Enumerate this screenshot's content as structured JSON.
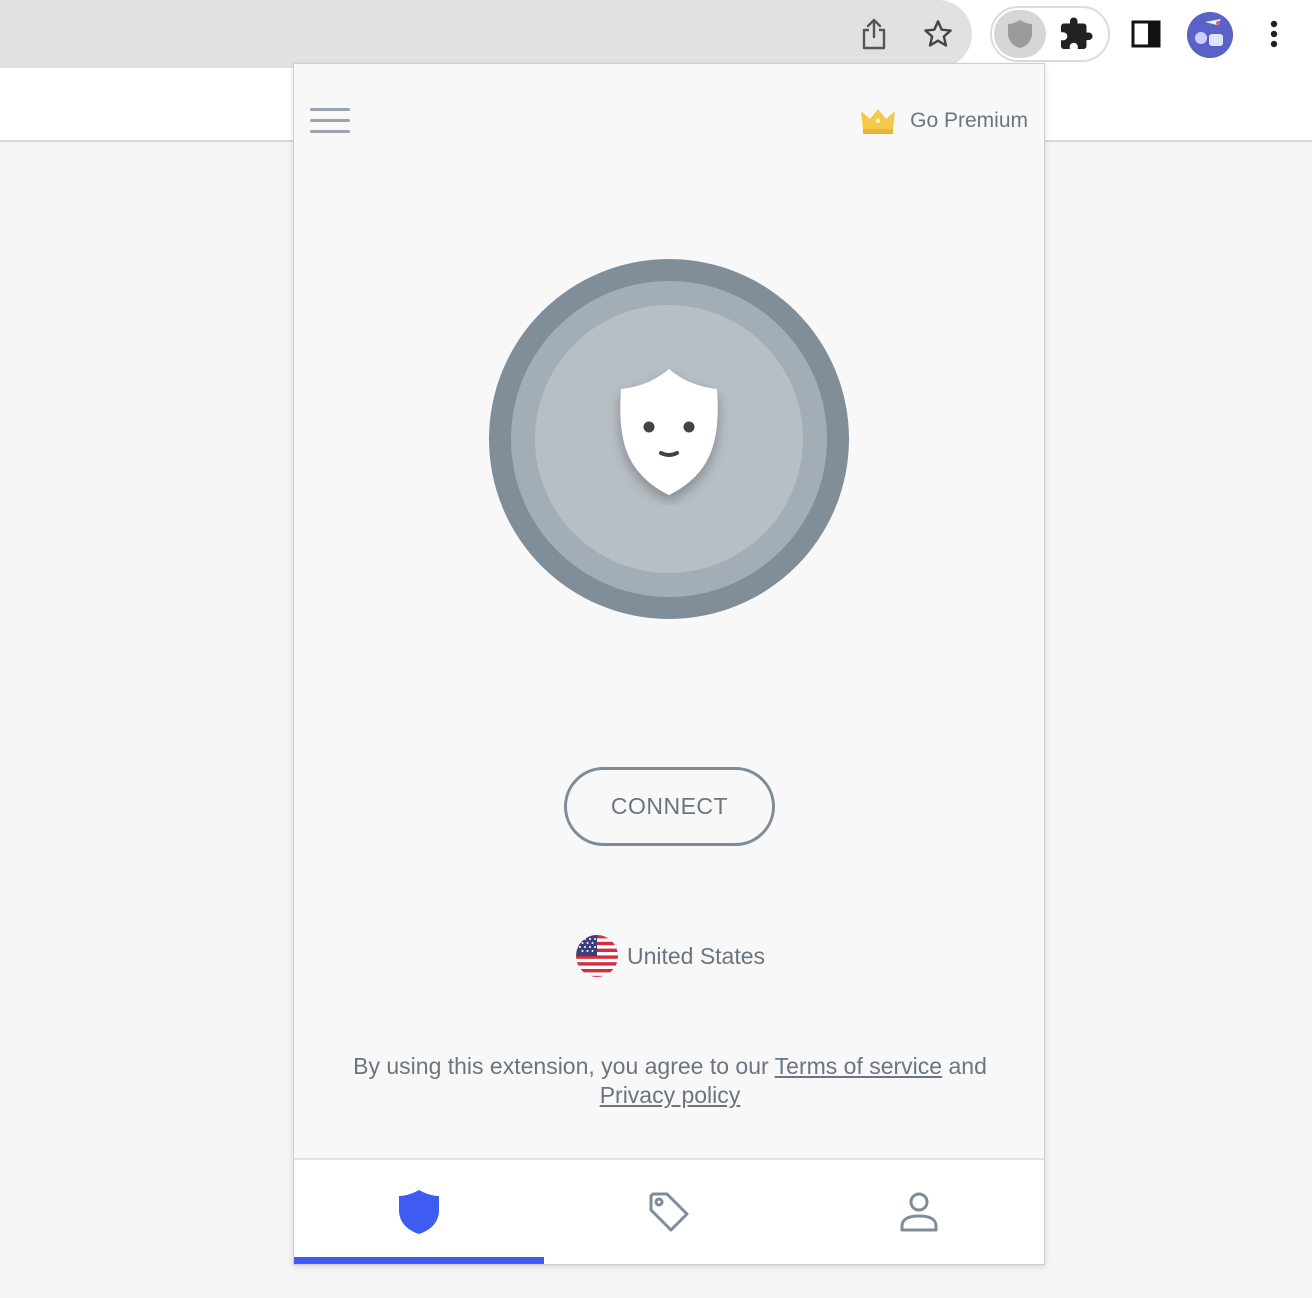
{
  "browser": {
    "toolbar_icons": [
      "share-icon",
      "star-icon",
      "vpn-extension-icon",
      "puzzle-icon",
      "side-panel-icon",
      "avatar",
      "more-vert-icon"
    ]
  },
  "popup": {
    "header": {
      "menu_icon": "hamburger-icon",
      "premium_icon": "crown-icon",
      "premium_label": "Go Premium"
    },
    "connect_button_label": "CONNECT",
    "location": {
      "flag_icon": "us-flag-icon",
      "label": "United States"
    },
    "legal": {
      "prefix": "By using this extension, you agree to our",
      "terms_link": "Terms of service",
      "conjunction": "and",
      "privacy_link": "Privacy policy"
    },
    "bottom_nav": {
      "tabs": [
        {
          "icon": "shield-icon",
          "active": true
        },
        {
          "icon": "tag-icon",
          "active": false
        },
        {
          "icon": "user-icon",
          "active": false
        }
      ]
    }
  },
  "colors": {
    "accent": "#3e5bf2",
    "text_muted": "#6b7580",
    "orb_outer": "#808e99",
    "orb_middle": "#a3adb6",
    "orb_inner": "#b7bec4",
    "crown": "#f7c948"
  }
}
